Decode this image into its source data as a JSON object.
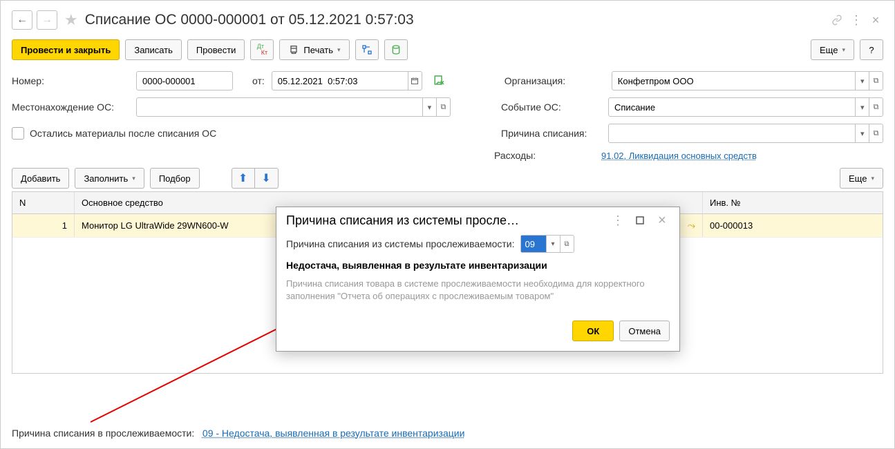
{
  "header": {
    "title": "Списание ОС 0000-000001 от 05.12.2021 0:57:03"
  },
  "toolbar": {
    "submit": "Провести и закрыть",
    "save": "Записать",
    "post": "Провести",
    "print": "Печать",
    "more": "Еще"
  },
  "fields": {
    "number_label": "Номер:",
    "number_value": "0000-000001",
    "date_label": "от:",
    "date_value": "05.12.2021  0:57:03",
    "location_label": "Местонахождение ОС:",
    "materials_left": "Остались материалы после списания ОС",
    "org_label": "Организация:",
    "org_value": "Конфетпром ООО",
    "event_label": "Событие ОС:",
    "event_value": "Списание",
    "reason_label": "Причина списания:",
    "expenses_label": "Расходы:",
    "expenses_link": "91.02, Ликвидация основных средств"
  },
  "table_tb": {
    "add": "Добавить",
    "fill": "Заполнить",
    "pick": "Подбор",
    "more": "Еще"
  },
  "table": {
    "cols": {
      "n": "N",
      "asset": "Основное средство",
      "inv": "Инв. №"
    },
    "row": {
      "n": "1",
      "asset": "Монитор LG UltraWide 29WN600-W",
      "inv": "00-000013"
    }
  },
  "footer": {
    "label": "Причина списания в прослеживаемости:",
    "link": "09 - Недостача, выявленная в результате инвентаризации"
  },
  "dialog": {
    "title": "Причина списания из системы просле…",
    "field_label": "Причина списания из системы прослеживаемости:",
    "field_value": "09",
    "selected_text": "Недостача, выявленная в результате инвентаризации",
    "hint": "Причина списания товара в системе прослеживаемости необходима для корректного заполнения \"Отчета об операциях с прослеживаемым товаром\"",
    "ok": "ОК",
    "cancel": "Отмена"
  }
}
